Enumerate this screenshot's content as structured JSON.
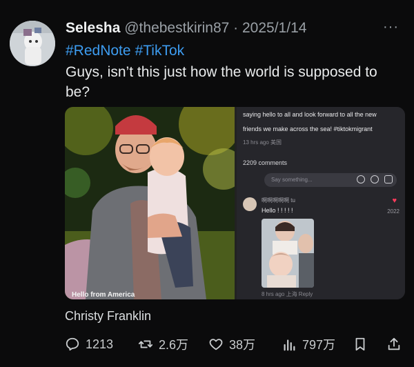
{
  "author": {
    "name": "Selesha",
    "handle": "@thebestkirin87",
    "separator": "·",
    "date": "2025/1/14"
  },
  "more_label": "···",
  "hashtags": [
    "#RedNote",
    "#TikTok"
  ],
  "body_text": "Guys, isn’t this just how the world is supposed to be?",
  "media": {
    "left_caption": "Hello from America",
    "screenshot": {
      "line1": "saying hello to all and look forward to all the new",
      "line2": "friends we make across the sea!  #tiktokmigrant",
      "meta": "13 hrs ago 美国",
      "comments_count": "2209 comments",
      "input_placeholder": "Say something...",
      "comment_user": "啊啊啊啊啊 tu",
      "comment_text": "Hello ! ! ! ! !",
      "comment_likes": "2022",
      "reply_meta": "8 hrs ago 上海 Reply"
    }
  },
  "location_label": "Christy Franklin",
  "actions": {
    "replies": "1213",
    "reposts": "2.6万",
    "likes": "38万",
    "views": "797万"
  },
  "colors": {
    "background": "#0b0b0c",
    "hashtag": "#3d9cf0",
    "muted": "#9aa0a6"
  }
}
